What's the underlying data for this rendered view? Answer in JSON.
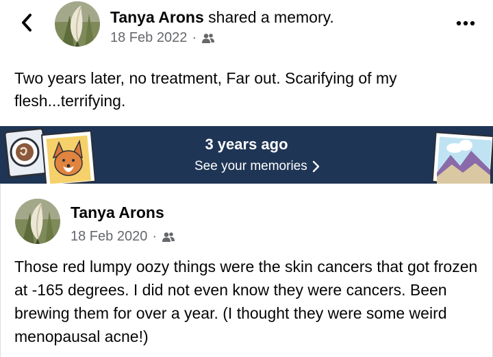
{
  "header": {
    "back_icon": "chevron-left-icon",
    "author": "Tanya Arons",
    "action": " shared a memory.",
    "date": "18 Feb 2022",
    "separator": "·",
    "audience_icon": "friends-icon",
    "more_icon": "more-horizontal-icon"
  },
  "post": {
    "text": "Two years later, no treatment, Far out.  Scarifying of my flesh...terrifying."
  },
  "memory_banner": {
    "title": "3 years ago",
    "link_label": "See your memories",
    "link_icon": "chevron-right-icon",
    "background": "#1f3556"
  },
  "shared_post": {
    "author": "Tanya Arons",
    "date": "18 Feb 2020",
    "separator": "·",
    "audience_icon": "friends-icon",
    "text": "Those red lumpy oozy things were the skin cancers that got frozen at -165 degrees.  I did not even know they were cancers.  Been brewing them for over a year.  (I thought they were some weird menopausal acne!)"
  }
}
